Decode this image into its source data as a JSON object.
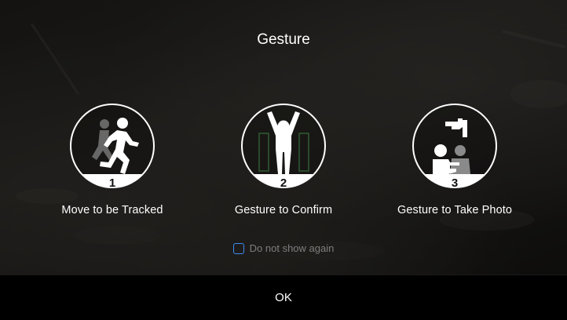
{
  "dialog": {
    "title": "Gesture",
    "steps": [
      {
        "number": "1",
        "label": "Move to be Tracked",
        "icon": "running-person-icon"
      },
      {
        "number": "2",
        "label": "Gesture to Confirm",
        "icon": "arms-raised-person-icon"
      },
      {
        "number": "3",
        "label": "Gesture to Take Photo",
        "icon": "photo-frame-gesture-icon"
      }
    ],
    "checkbox": {
      "label": "Do not show again",
      "checked": false
    },
    "ok_label": "OK"
  },
  "colors": {
    "accent": "#3d8bf0",
    "text": "#ffffff",
    "muted_text": "#7d7d7d"
  }
}
